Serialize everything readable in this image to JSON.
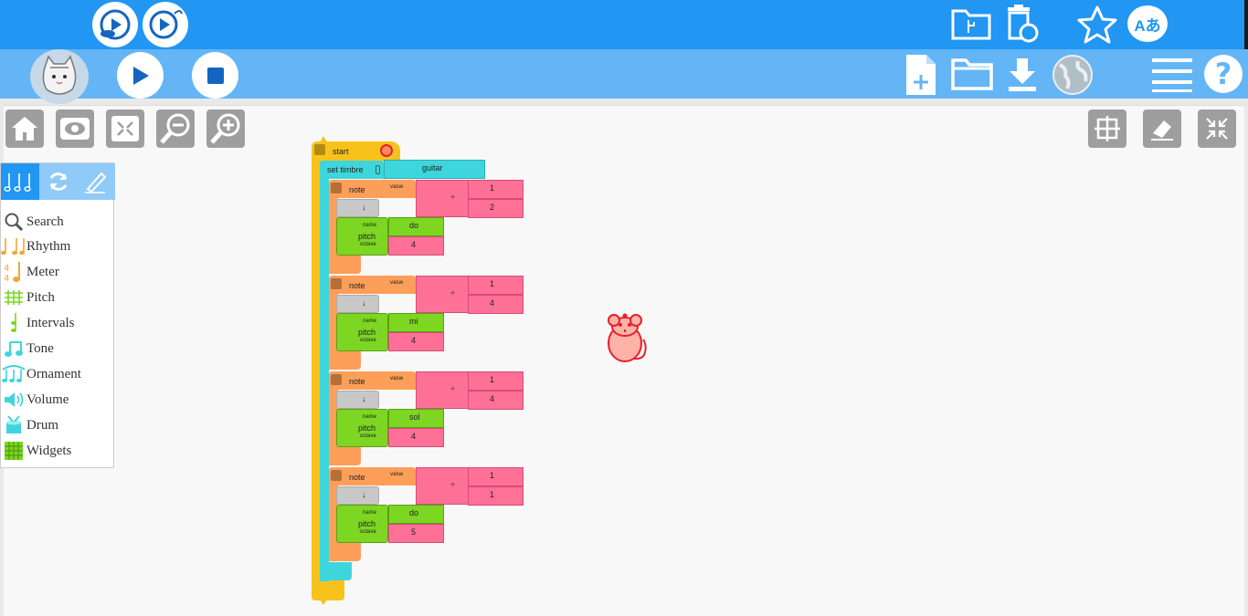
{
  "toolbar_top": {
    "right_icons": [
      "plugin-folder-icon",
      "delete-restore-icon",
      "star-icon",
      "language-icon"
    ],
    "language_label": "Aあ"
  },
  "toolbar_sub": {
    "right_icons": [
      "new-file-icon",
      "open-folder-icon",
      "save-download-icon",
      "globe-icon",
      "menu-icon",
      "help-icon"
    ],
    "help_label": "?"
  },
  "canvas_tools": {
    "left": [
      "home-icon",
      "eye-icon",
      "collapse-icon",
      "zoom-out-icon",
      "zoom-in-icon"
    ],
    "right": [
      "grid-icon",
      "eraser-icon",
      "shrink-icon"
    ]
  },
  "palette": {
    "items": [
      {
        "label": "Search",
        "color": "#555555"
      },
      {
        "label": "Rhythm",
        "color": "#f2a73b"
      },
      {
        "label": "Meter",
        "color": "#f2a73b"
      },
      {
        "label": "Pitch",
        "color": "#7cd622"
      },
      {
        "label": "Intervals",
        "color": "#7cd622"
      },
      {
        "label": "Tone",
        "color": "#3ed6dc"
      },
      {
        "label": "Ornament",
        "color": "#3ed6dc"
      },
      {
        "label": "Volume",
        "color": "#3ed6dc"
      },
      {
        "label": "Drum",
        "color": "#3ed6dc"
      },
      {
        "label": "Widgets",
        "color": "#7cd622"
      }
    ]
  },
  "program": {
    "start_label": "start",
    "set_timbre_label": "set timbre",
    "timbre_value": "guitar",
    "note_label": "note",
    "value_label": "value",
    "divide_symbol": "÷",
    "arrow_label": "↓",
    "name_label": "name",
    "pitch_label": "pitch",
    "octave_label": "octave",
    "notes": [
      {
        "numerator": "1",
        "denominator": "2",
        "pitch": "do",
        "octave": "4"
      },
      {
        "numerator": "1",
        "denominator": "4",
        "pitch": "mi",
        "octave": "4"
      },
      {
        "numerator": "1",
        "denominator": "4",
        "pitch": "sol",
        "octave": "4"
      },
      {
        "numerator": "1",
        "denominator": "1",
        "pitch": "do",
        "octave": "5"
      }
    ]
  },
  "colors": {
    "top_bar": "#2196f3",
    "sub_bar": "#64b5f6",
    "start_block": "#f8c21c",
    "timbre_block": "#3ed6dc",
    "note_block": "#fd9f59",
    "arith_block": "#ff7097",
    "pitch_block": "#7cd622",
    "mouse": "#e8202c"
  }
}
